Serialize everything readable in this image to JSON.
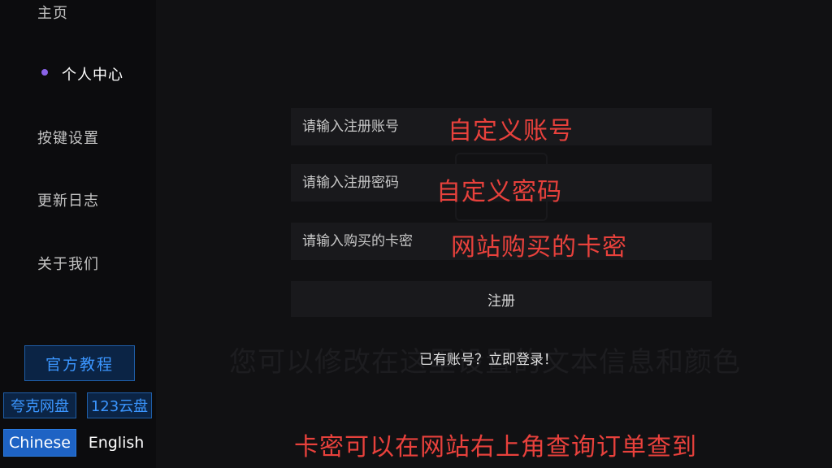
{
  "sidebar": {
    "items": [
      {
        "label": "主页"
      },
      {
        "label": "个人中心"
      },
      {
        "label": "按键设置"
      },
      {
        "label": "更新日志"
      },
      {
        "label": "关于我们"
      }
    ],
    "tutorial_label": "官方教程",
    "pan_links": [
      {
        "label": "夸克网盘"
      },
      {
        "label": "123云盘"
      }
    ],
    "languages": {
      "active": "Chinese",
      "other": "English"
    }
  },
  "form": {
    "account_placeholder": "请输入注册账号",
    "password_placeholder": "请输入注册密码",
    "card_placeholder": "请输入购买的卡密",
    "register_label": "注册",
    "login_link": "已有账号？立即登录！"
  },
  "annotations": {
    "account": "自定义账号",
    "password": "自定义密码",
    "card": "网站购买的卡密",
    "bottom": "卡密可以在网站右上角查询订单查到"
  },
  "background_text": "您可以修改在这里设置的文本信息和颜色",
  "colors": {
    "accent_purple": "#8a63e8",
    "link_blue": "#3b96ff",
    "annotation_red": "#e8413c"
  }
}
